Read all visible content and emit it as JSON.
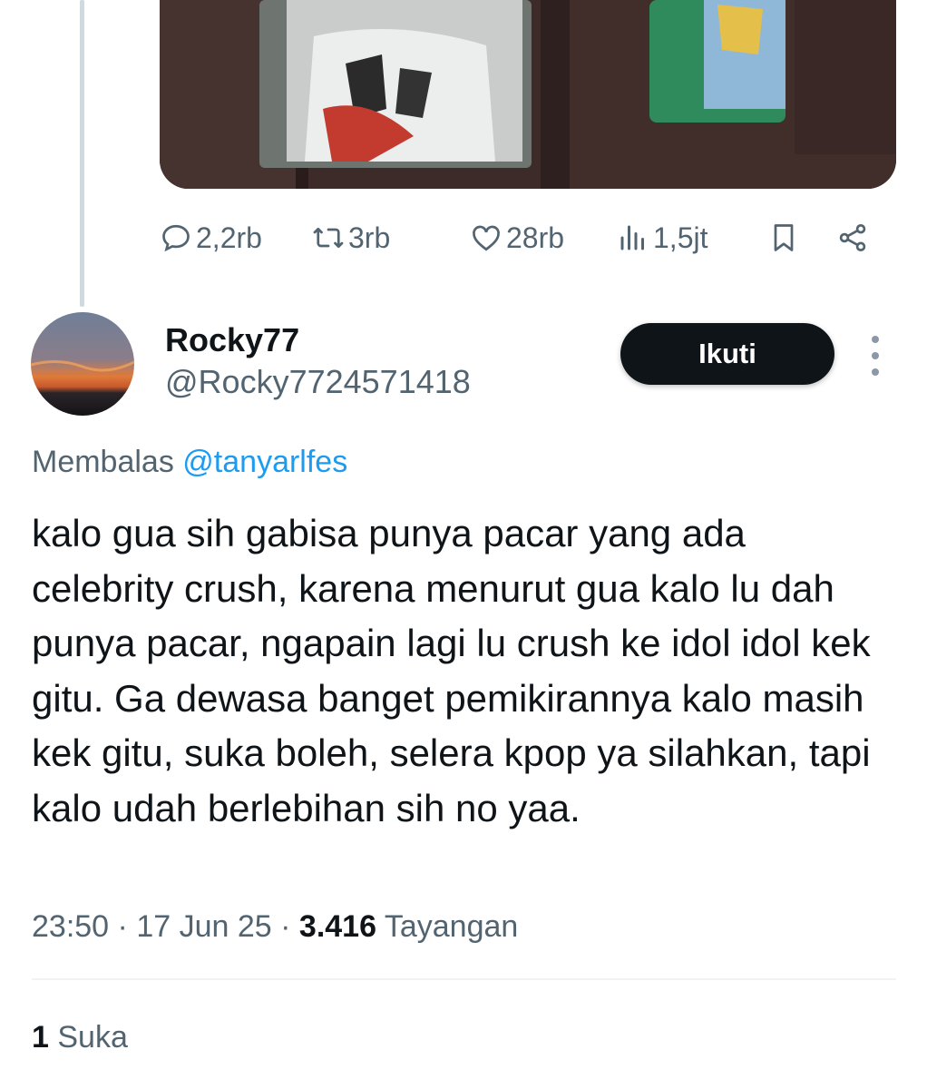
{
  "media": {
    "icon": "tweet-image-wallet-photo"
  },
  "actions": {
    "replies": "2,2rb",
    "reposts": "3rb",
    "likes": "28rb",
    "views": "1,5jt"
  },
  "reply": {
    "author_name": "Rocky77",
    "author_handle": "@Rocky7724571418",
    "follow_label": "Ikuti",
    "replying_prefix": "Membalas",
    "replying_to": "@tanyarlfes",
    "text": "kalo gua sih gabisa punya pacar yang ada celebrity crush, karena menurut gua kalo lu dah punya pacar, ngapain lagi lu crush ke idol idol kek gitu. Ga dewasa banget pemikirannya kalo masih kek gitu, suka boleh, selera kpop ya silahkan, tapi kalo udah berlebihan sih no yaa.",
    "time": "23:50",
    "date": "17 Jun 25",
    "sep": "·",
    "views_count": "3.416",
    "views_label": "Tayangan",
    "likes_count": "1",
    "likes_label": "Suka"
  },
  "colors": {
    "accent": "#1d9bf0",
    "text_primary": "#0f1419",
    "text_secondary": "#536471",
    "button_bg": "#0f1419"
  }
}
